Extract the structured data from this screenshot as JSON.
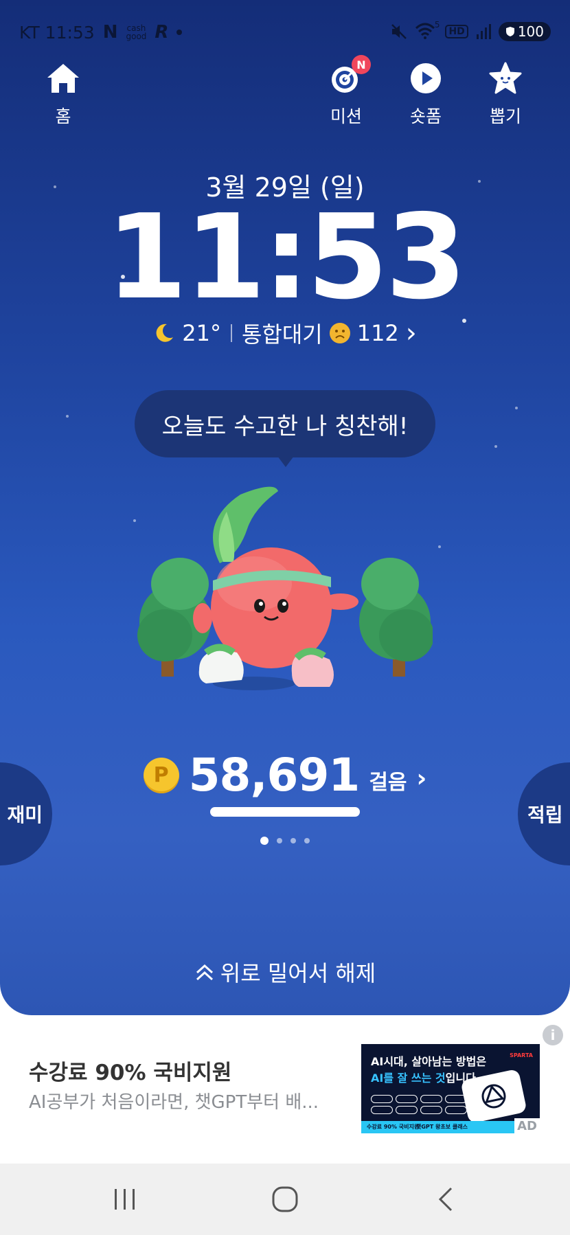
{
  "status_bar": {
    "carrier_time": "KT 11:53",
    "icons_left": [
      "n-app-icon",
      "cashwalk-icon",
      "runner-icon",
      "dot-icon"
    ],
    "app_label_n": "N",
    "app_label_cash": "cash",
    "app_label_good": "good",
    "app_label_r": "R",
    "icons_right": [
      "mute-icon",
      "wifi-icon",
      "hd-icon",
      "signal-icon"
    ],
    "wifi_label": "5",
    "hd_label": "HD",
    "battery": "100"
  },
  "nav": {
    "home": "홈",
    "mission": "미션",
    "mission_badge": "N",
    "shorts": "숏폼",
    "draw": "뽑기"
  },
  "clock": {
    "date": "3월 29일 (일)",
    "time": "11:53"
  },
  "weather": {
    "temp": "21°",
    "air_label": "통합대기",
    "air_value": "112",
    "chevron": "›"
  },
  "bubble": {
    "text": "오늘도 수고한 나 칭찬해!"
  },
  "steps": {
    "coin": "P",
    "count": "58,691",
    "unit": "걸음",
    "chevron": "›"
  },
  "pager": {
    "total": 4,
    "active": 0
  },
  "side": {
    "left": "재미",
    "right": "적립"
  },
  "unlock": {
    "text": "위로 밀어서 해제"
  },
  "ad": {
    "info": "i",
    "title": "수강료 90% 국비지원",
    "subtitle": "AI공부가 처음이라면, 챗GPT부터 배...",
    "image_line1": "AI시대, 살아남는 방법은",
    "image_line2_highlight": "AI를 잘 쓰는 것",
    "image_line2_rest": "입니다",
    "image_brand": "SPARTA",
    "image_strip1": "수강료 90% 국비지원",
    "image_strip2": "챗GPT 왕초보 클래스",
    "ad_mark": "AD"
  },
  "colors": {
    "bg_top": "#142d78",
    "bg_bottom": "#3560c2",
    "bubble": "#1c3576",
    "coin": "#f6c52d",
    "badge": "#f0465c"
  }
}
